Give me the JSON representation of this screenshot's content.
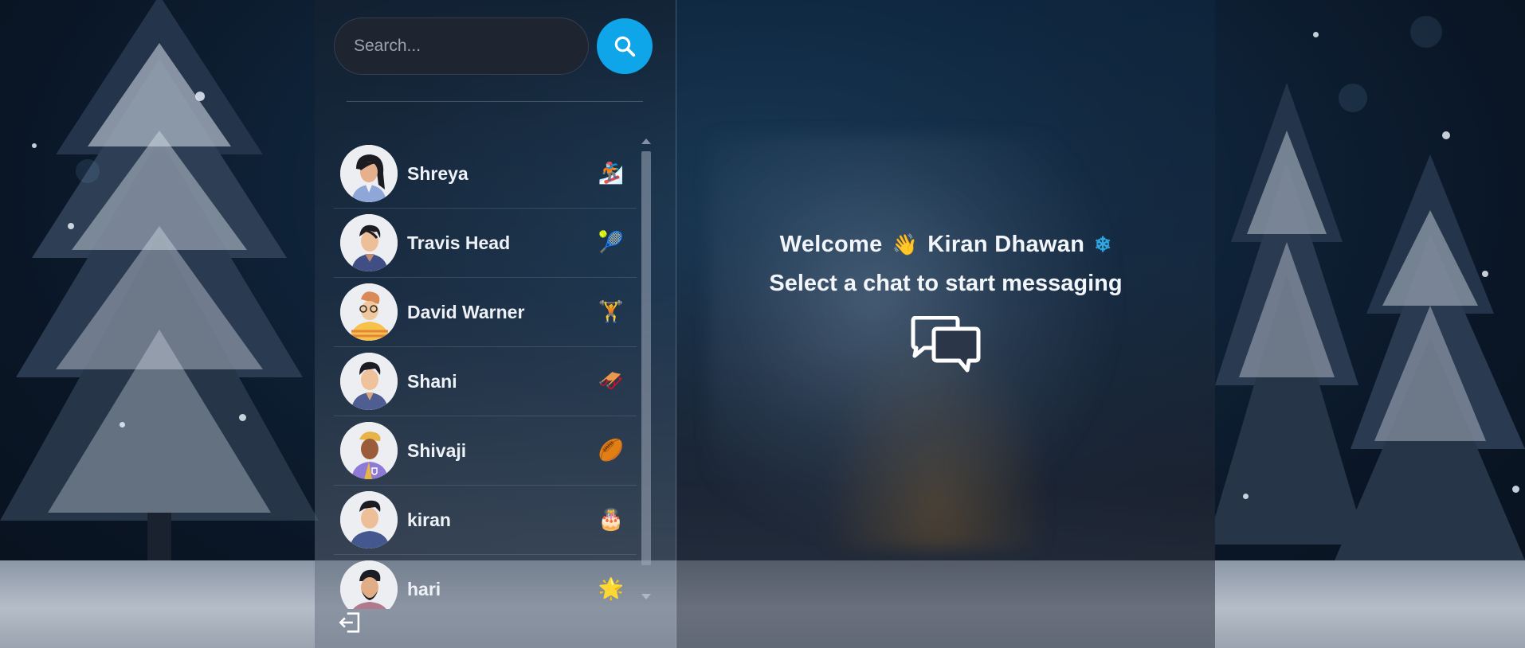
{
  "search": {
    "placeholder": "Search..."
  },
  "chats": [
    {
      "name": "Shreya",
      "emoji": "🏂"
    },
    {
      "name": "Travis Head",
      "emoji": "🎾"
    },
    {
      "name": "David Warner",
      "emoji": "🏋"
    },
    {
      "name": "Shani",
      "emoji": "🛷"
    },
    {
      "name": "Shivaji",
      "emoji": "🏉"
    },
    {
      "name": "kiran",
      "emoji": "🎂"
    },
    {
      "name": "hari",
      "emoji": "🌟"
    }
  ],
  "welcome": {
    "greeting": "Welcome",
    "wave_emoji": "👋",
    "user_name": "Kiran Dhawan",
    "snow_emoji": "❄",
    "subtitle": "Select a chat to start messaging"
  },
  "colors": {
    "accent": "#0ea5e9"
  }
}
